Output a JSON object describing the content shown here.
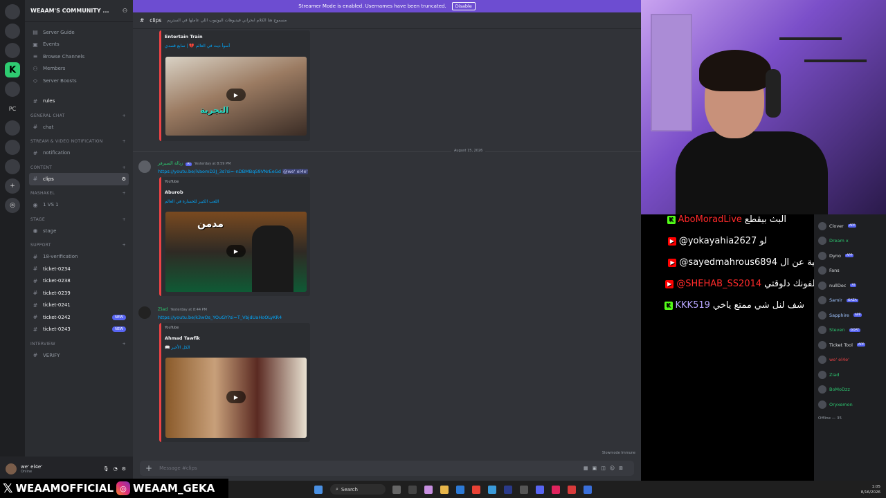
{
  "discord": {
    "server_name": "WEAAM'S COMMUNITY ...",
    "streamer_banner": "Streamer Mode is enabled. Usernames have been truncated.",
    "disable_label": "Disable",
    "nav": [
      "Server Guide",
      "Events",
      "Browse Channels",
      "Members",
      "Server Boosts"
    ],
    "rules": "rules",
    "categories": [
      {
        "name": "GENERAL CHAT",
        "channels": [
          "chat"
        ]
      },
      {
        "name": "STREAM & VIDEO NOTIFICATION",
        "channels": [
          "notification"
        ]
      },
      {
        "name": "CONTENT",
        "channels": [
          "clips"
        ]
      },
      {
        "name": "MASHAKEL",
        "channels": [
          "1 VS 1"
        ]
      },
      {
        "name": "STAGE",
        "channels": [
          "stage"
        ]
      },
      {
        "name": "SUPPORT",
        "channels": [
          "18-verification",
          "ticket-0234",
          "ticket-0238",
          "ticket-0239",
          "ticket-0241",
          "ticket-0242",
          "ticket-0243"
        ]
      },
      {
        "name": "INTERVIEW",
        "channels": [
          "VERIFY"
        ]
      }
    ],
    "new_badge": "NEW",
    "channel_header": "clips",
    "channel_topic": "مسموح هنا الكلام ابحراني فيديوهات اليوتيوب اللي عاملها في الستريم",
    "messages": [
      {
        "embed_author": "Entertain Train",
        "embed_title": "أسوأ ديت في العالم 💔 | سابع قصدي"
      },
      {
        "user": "زبالة السيرفر",
        "timestamp": "Yesterday at 8:59 PM",
        "link": "https://youtu.be/iVaomD3J_3s?si=-nDBMBqS9VNrEeGd",
        "mention": "@we' el4e'",
        "embed_provider": "YouTube",
        "embed_author": "Aburob",
        "embed_title": "اللعب الكبير للخسارة في العالم",
        "thumb_caption": "مدمن"
      },
      {
        "user": "Ziad",
        "timestamp": "Yesterday at 8:44 PM",
        "link": "https://youtu.be/k3wOs_YOuGY?si=T_VbjdUaHoOLyKR4",
        "embed_provider": "YouTube",
        "embed_author": "Ahmad Tawfik",
        "embed_title": "📖 الكل الأخير"
      }
    ],
    "date_separator": "August 15, 2026",
    "composer_placeholder": "Message #clips",
    "slowmode": "Slowmode Immune",
    "user_name": "we' el4e'",
    "user_status": "Online",
    "ai_badge": "AI"
  },
  "chat_overlay": [
    {
      "platform": "kick",
      "user": "AboMoradLive",
      "user_color": "#ff2a2a",
      "text": "البث بيقطع"
    },
    {
      "platform": "youtube",
      "user": "@yokayahia2627",
      "user_color": "#ffffff",
      "text": "لو"
    },
    {
      "platform": "youtube",
      "user": "@sayedmahrous6894",
      "user_color": "#ffffff",
      "text": "اعمل حلقة تانية عن ال SCF"
    },
    {
      "platform": "youtube",
      "user": "@SHEHAB_SS2014",
      "user_color": "#ff2a2a",
      "text": "لو راجل قول رقم تلفونك دلوقتي"
    },
    {
      "platform": "kick",
      "user": "KKK519",
      "user_color": "#b7a6ff",
      "text": "شف لنل شي ممتع ياخي"
    }
  ],
  "members": [
    {
      "name": "Clover",
      "tag": "APP",
      "color": "#dbdee1"
    },
    {
      "name": "Dream x",
      "tag": "",
      "color": "#2dc770"
    },
    {
      "name": "Dyno",
      "tag": "APP",
      "color": "#dbdee1"
    },
    {
      "name": "Fans",
      "tag": "",
      "color": "#dbdee1"
    },
    {
      "name": "nullDec",
      "tag": "AI",
      "color": "#dbdee1"
    },
    {
      "name": "Samir",
      "tag": "GAZA",
      "color": "#a0c4ff"
    },
    {
      "name": "Sapphire",
      "tag": "APP",
      "color": "#a0c4ff"
    },
    {
      "name": "Steven",
      "tag": "GOAT",
      "color": "#2dc770"
    },
    {
      "name": "Ticket Tool",
      "tag": "APP",
      "color": "#dbdee1"
    },
    {
      "name": "we' el4e'",
      "tag": "",
      "color": "#ed4245"
    },
    {
      "name": "Ziad",
      "tag": "",
      "color": "#2dc770"
    },
    {
      "name": "BoMoDzz",
      "tag": "",
      "color": "#2dc770"
    },
    {
      "name": "Oryxemon",
      "tag": "",
      "color": "#2dc770"
    }
  ],
  "offline_label": "Offline — 35",
  "socials": {
    "x": "WEAAMOFFICIAL",
    "ig": "WEAAM_GEKA"
  },
  "taskbar": {
    "search": "Search",
    "time": "1:05",
    "date": "8/16/2026"
  }
}
